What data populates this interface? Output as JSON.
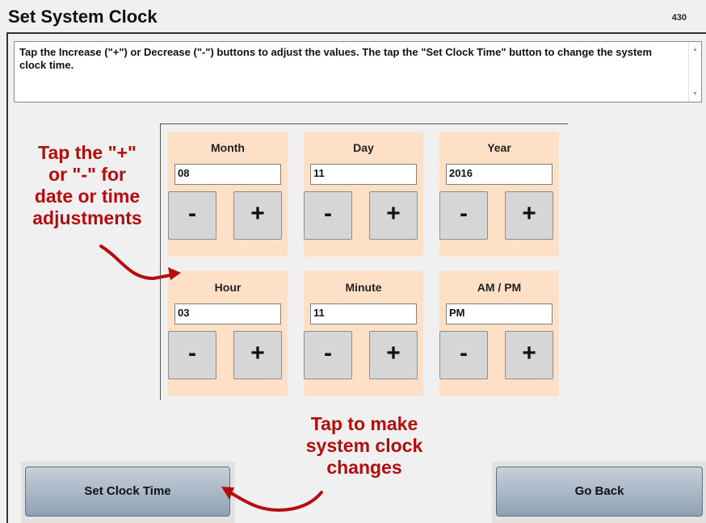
{
  "header": {
    "title": "Set System Clock",
    "screen_id": "430"
  },
  "instructions": {
    "text": "Tap the Increase (\"+\") or Decrease (\"-\") buttons to adjust the values. The tap the \"Set Clock Time\" button to change the system clock time."
  },
  "fields": {
    "month": {
      "label": "Month",
      "value": "08"
    },
    "day": {
      "label": "Day",
      "value": "11"
    },
    "year": {
      "label": "Year",
      "value": "2016"
    },
    "hour": {
      "label": "Hour",
      "value": "03"
    },
    "minute": {
      "label": "Minute",
      "value": "11"
    },
    "ampm": {
      "label": "AM / PM",
      "value": "PM"
    }
  },
  "buttons": {
    "minus": "-",
    "plus": "+",
    "set_clock": "Set Clock Time",
    "go_back": "Go Back"
  },
  "annotations": {
    "adjust_line1": "Tap the \"+\"",
    "adjust_line2": "or \"-\" for",
    "adjust_line3": "date or time",
    "adjust_line4": "adjustments",
    "set_line1": "Tap to make",
    "set_line2": "system clock",
    "set_line3": "changes"
  },
  "colors": {
    "field_background": "#fde0c6",
    "annotation": "#b40d0d",
    "button_gradient_top": "#c6d0da",
    "button_gradient_bottom": "#8ea1b3"
  }
}
